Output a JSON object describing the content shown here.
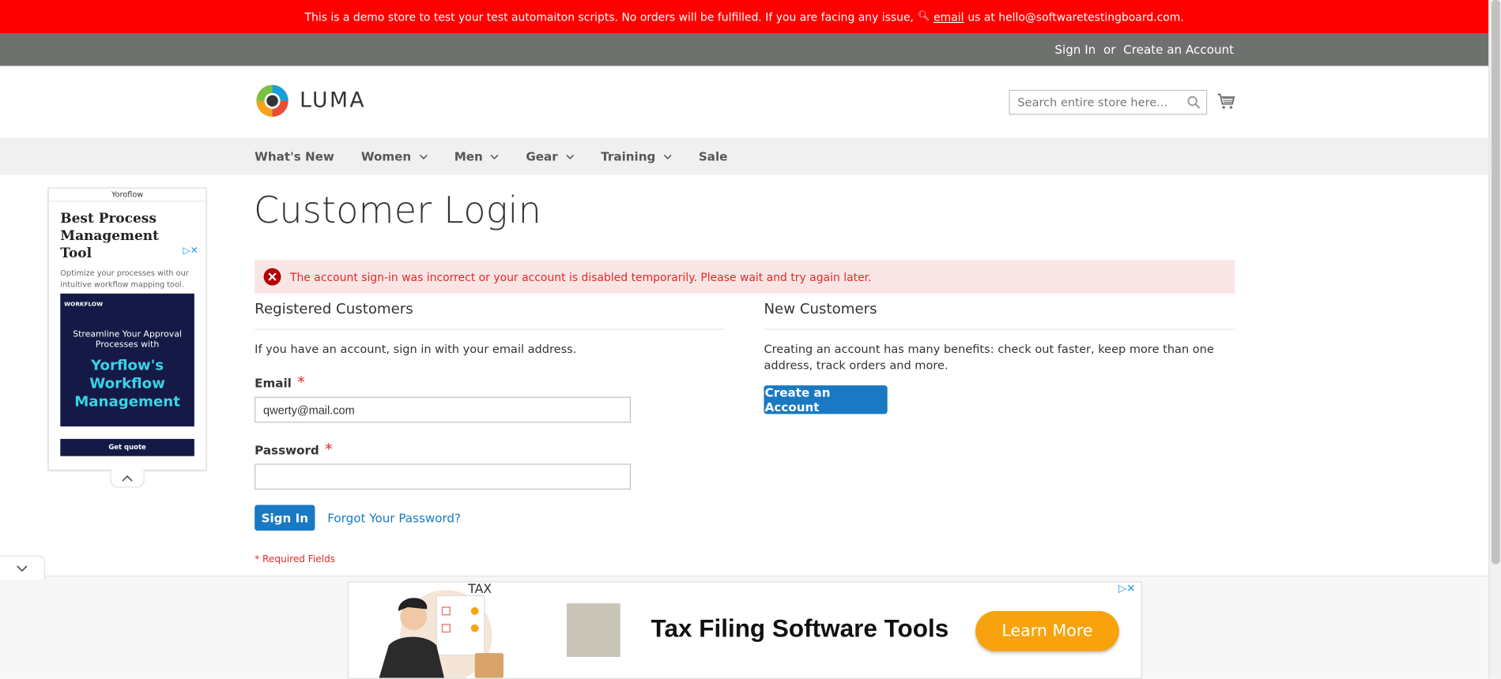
{
  "demo_notice": {
    "text": "This is a demo store to test your test automaiton scripts. No orders will be fulfilled. If you are facing any issue,",
    "email_label": "email",
    "suffix": "us at hello@softwaretestingboard.com."
  },
  "top_links": {
    "sign_in": "Sign In",
    "or": "or",
    "create_account": "Create an Account"
  },
  "logo": {
    "text": "LUMA"
  },
  "search": {
    "placeholder": "Search entire store here..."
  },
  "nav": {
    "items": [
      {
        "label": "What's New",
        "has_menu": false
      },
      {
        "label": "Women",
        "has_menu": true
      },
      {
        "label": "Men",
        "has_menu": true
      },
      {
        "label": "Gear",
        "has_menu": true
      },
      {
        "label": "Training",
        "has_menu": true
      },
      {
        "label": "Sale",
        "has_menu": false
      }
    ]
  },
  "ad_left": {
    "sponsor": "Yoroflow",
    "headline": "Best Process Management Tool",
    "description": "Optimize your processes with our intuitive workflow mapping tool.",
    "banner_brand": "WORKFLOW",
    "banner_line": "Streamline Your Approval Processes with",
    "banner_big": "Yorflow's Workflow Management",
    "cta": "Get quote"
  },
  "page": {
    "title": "Customer Login",
    "error": "The account sign-in was incorrect or your account is disabled temporarily. Please wait and try again later."
  },
  "registered": {
    "title": "Registered Customers",
    "note": "If you have an account, sign in with your email address.",
    "email_label": "Email",
    "email_value": "qwerty@mail.com",
    "password_label": "Password",
    "password_value": "",
    "sign_in_button": "Sign In",
    "forgot_link": "Forgot Your Password?",
    "required_note": "* Required Fields",
    "required_mark": "*"
  },
  "new_customers": {
    "title": "New Customers",
    "note": "Creating an account has many benefits: check out faster, keep more than one address, track orders and more.",
    "create_button": "Create an Account"
  },
  "ad_bottom": {
    "label": "TAX",
    "headline": "Tax Filing Software Tools",
    "cta": "Learn More"
  },
  "colors": {
    "demo_bar": "#ff0000",
    "top_bar": "#6e716e",
    "primary": "#1979c3",
    "error_bg": "#fae5e5",
    "error_text": "#e02b27",
    "ad_cta": "#f8a30d"
  }
}
